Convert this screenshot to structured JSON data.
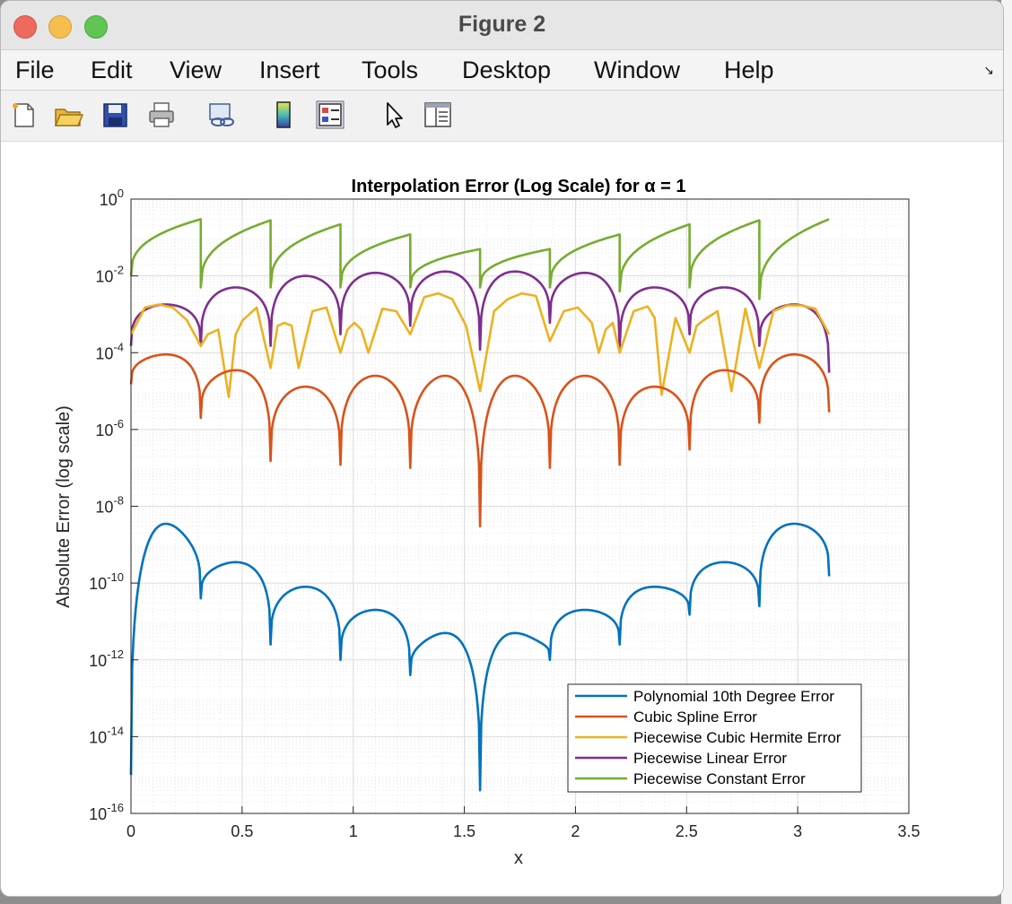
{
  "window": {
    "title": "Figure 2"
  },
  "menu": {
    "items": [
      "File",
      "Edit",
      "View",
      "Insert",
      "Tools",
      "Desktop",
      "Window",
      "Help"
    ]
  },
  "toolbar": {
    "icons": [
      "new-figure-icon",
      "open-folder-icon",
      "save-icon",
      "print-icon",
      "link-plot-icon",
      "colorbar-icon",
      "legend-icon",
      "pointer-icon",
      "property-inspector-icon"
    ]
  },
  "colors": {
    "blue": "#0072BD",
    "orange": "#D95319",
    "yellow": "#EDB120",
    "purple": "#7E2F8E",
    "green": "#77AC30"
  },
  "chart_data": {
    "type": "line",
    "title": "Interpolation Error (Log Scale) for α = 1",
    "xlabel": "x",
    "ylabel": "Absolute Error (log scale)",
    "xlim": [
      0,
      3.5
    ],
    "ylim": [
      1e-16,
      1
    ],
    "yscale": "log",
    "xticks": [
      "0",
      "0.5",
      "1",
      "1.5",
      "2",
      "2.5",
      "3",
      "3.5"
    ],
    "yticks": [
      {
        "base": "10",
        "exp": "0"
      },
      {
        "base": "10",
        "exp": "-2"
      },
      {
        "base": "10",
        "exp": "-4"
      },
      {
        "base": "10",
        "exp": "-6"
      },
      {
        "base": "10",
        "exp": "-8"
      },
      {
        "base": "10",
        "exp": "-10"
      },
      {
        "base": "10",
        "exp": "-12"
      },
      {
        "base": "10",
        "exp": "-14"
      },
      {
        "base": "10",
        "exp": "-16"
      }
    ],
    "grid": true,
    "minor_grid": true,
    "legend_position": "bottom-right",
    "x_range": [
      0,
      3.1416
    ],
    "nodes": [
      0,
      0.3142,
      0.6283,
      0.9425,
      1.2566,
      1.5708,
      1.885,
      2.1991,
      2.5133,
      2.8274,
      3.1416
    ],
    "series": [
      {
        "name": "Polynomial 10th Degree Error",
        "color": "#0072BD",
        "peaks": [
          3.5e-09,
          3.5e-10,
          8e-11,
          2e-11,
          5e-12,
          5e-12,
          2e-11,
          8e-11,
          3.5e-10,
          3.5e-09
        ],
        "dips": [
          1e-15,
          4e-11,
          2.5e-12,
          1e-12,
          4e-13,
          4e-16,
          1e-12,
          2.5e-12,
          1.5e-11,
          2.5e-11,
          1.5e-10
        ]
      },
      {
        "name": "Cubic Spline Error",
        "color": "#D95319",
        "peaks": [
          9e-05,
          3.5e-05,
          1.3e-05,
          2.5e-05,
          2.5e-05,
          2.5e-05,
          2.5e-05,
          1.3e-05,
          3.5e-05,
          9e-05
        ],
        "dips": [
          1.5e-05,
          2e-06,
          1.5e-07,
          1.2e-07,
          1e-07,
          3e-09,
          1e-07,
          1.2e-07,
          3e-07,
          1.5e-06,
          2.8e-06
        ]
      },
      {
        "name": "Piecewise Cubic Hermite Error",
        "color": "#EDB120",
        "x": [
          0,
          0.0628,
          0.1257,
          0.1885,
          0.2513,
          0.3142,
          0.3456,
          0.3927,
          0.4398,
          0.4712,
          0.5027,
          0.5655,
          0.6283,
          0.6597,
          0.6912,
          0.7226,
          0.754,
          0.8168,
          0.8796,
          0.9425,
          0.9738,
          1.0053,
          1.0367,
          1.0681,
          1.131,
          1.1938,
          1.2566,
          1.3195,
          1.3823,
          1.4451,
          1.5079,
          1.5708,
          1.6336,
          1.6965,
          1.7593,
          1.8221,
          1.885,
          1.9478,
          2.0106,
          2.0735,
          2.1049,
          2.1363,
          2.1677,
          2.1991,
          2.262,
          2.3248,
          2.3562,
          2.3876,
          2.4504,
          2.5133,
          2.5447,
          2.5761,
          2.6389,
          2.7018,
          2.7646,
          2.8274,
          2.8903,
          2.9531,
          3.0159,
          3.0788,
          3.1416
        ],
        "y": [
          0.0003,
          0.0015,
          0.0018,
          0.0015,
          0.0007,
          0.00015,
          0.0003,
          0.0004,
          7e-06,
          0.0003,
          0.0007,
          0.0015,
          4e-05,
          0.0005,
          0.0006,
          0.0005,
          4e-05,
          0.0012,
          0.0015,
          0.0001,
          0.0004,
          0.0006,
          0.0004,
          0.0001,
          0.0014,
          0.0012,
          0.0003,
          0.0028,
          0.0035,
          0.0025,
          0.0005,
          1e-05,
          0.0012,
          0.0025,
          0.0035,
          0.003,
          0.0002,
          0.0012,
          0.0015,
          0.0006,
          0.0001,
          0.0004,
          0.0006,
          0.0001,
          0.0012,
          0.0016,
          0.0008,
          8e-06,
          0.0008,
          0.0001,
          0.0005,
          0.0007,
          0.0012,
          1e-05,
          0.0014,
          4e-05,
          0.0012,
          0.0017,
          0.0017,
          0.0014,
          0.0003
        ]
      },
      {
        "name": "Piecewise Linear Error",
        "color": "#7E2F8E",
        "peaks": [
          0.0018,
          0.005,
          0.01,
          0.012,
          0.013,
          0.013,
          0.012,
          0.005,
          0.005,
          0.0018
        ],
        "dips": [
          0.00015,
          0.00015,
          0.00015,
          0.0003,
          0.0005,
          0.00012,
          0.0006,
          0.00012,
          0.0003,
          0.00015,
          3e-05
        ]
      },
      {
        "name": "Piecewise Constant Error",
        "color": "#77AC30",
        "start": [
          0.01,
          0.005,
          0.005,
          0.005,
          0.005,
          0.005,
          0.005,
          0.004,
          0.005,
          0.0025
        ],
        "end": [
          0.3,
          0.28,
          0.22,
          0.12,
          0.05,
          0.05,
          0.12,
          0.22,
          0.28,
          0.3
        ]
      }
    ]
  }
}
